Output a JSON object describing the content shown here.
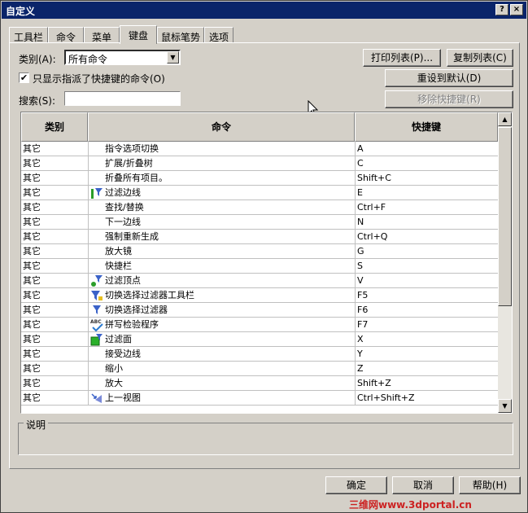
{
  "window": {
    "title": "自定义",
    "help_btn": "?",
    "close_btn": "×"
  },
  "tabs": [
    {
      "label": "工具栏"
    },
    {
      "label": "命令"
    },
    {
      "label": "菜单"
    },
    {
      "label": "键盘"
    },
    {
      "label": "鼠标笔势"
    },
    {
      "label": "选项"
    }
  ],
  "active_tab": "键盘",
  "category": {
    "label": "类别(A):",
    "value": "所有命令"
  },
  "buttons": {
    "print_list": "打印列表(P)...",
    "copy_list": "复制列表(C)",
    "reset_default": "重设到默认(D)",
    "remove_shortcut": "移除快捷键(R)"
  },
  "only_assigned": {
    "label": "只显示指派了快捷键的命令(O)",
    "checked": true,
    "mark": "✔"
  },
  "search": {
    "label": "搜索(S):",
    "value": ""
  },
  "table": {
    "headers": [
      "类别",
      "命令",
      "快捷键"
    ],
    "rows": [
      {
        "category": "其它",
        "icon": "",
        "command": "指令选项切换",
        "shortcut": "A"
      },
      {
        "category": "其它",
        "icon": "",
        "command": "扩展/折叠树",
        "shortcut": "C"
      },
      {
        "category": "其它",
        "icon": "",
        "command": "折叠所有项目。",
        "shortcut": "Shift+C"
      },
      {
        "category": "其它",
        "icon": "filter-edge-icon",
        "command": "过滤边线",
        "shortcut": "E"
      },
      {
        "category": "其它",
        "icon": "",
        "command": "查找/替换",
        "shortcut": "Ctrl+F"
      },
      {
        "category": "其它",
        "icon": "",
        "command": "下一边线",
        "shortcut": "N"
      },
      {
        "category": "其它",
        "icon": "",
        "command": "强制重新生成",
        "shortcut": "Ctrl+Q"
      },
      {
        "category": "其它",
        "icon": "",
        "command": "放大镜",
        "shortcut": "G"
      },
      {
        "category": "其它",
        "icon": "",
        "command": "快捷栏",
        "shortcut": "S"
      },
      {
        "category": "其它",
        "icon": "filter-vertex-icon",
        "command": "过滤顶点",
        "shortcut": "V"
      },
      {
        "category": "其它",
        "icon": "filter-toolbar-icon",
        "command": "切换选择过滤器工具栏",
        "shortcut": "F5"
      },
      {
        "category": "其它",
        "icon": "filter-icon",
        "command": "切换选择过滤器",
        "shortcut": "F6"
      },
      {
        "category": "其它",
        "icon": "spellcheck-icon",
        "command": "拼写检验程序",
        "shortcut": "F7"
      },
      {
        "category": "其它",
        "icon": "filter-face-icon",
        "command": "过滤面",
        "shortcut": "X"
      },
      {
        "category": "其它",
        "icon": "",
        "command": "接受边线",
        "shortcut": "Y"
      },
      {
        "category": "其它",
        "icon": "",
        "command": "缩小",
        "shortcut": "Z"
      },
      {
        "category": "其它",
        "icon": "",
        "command": "放大",
        "shortcut": "Shift+Z"
      },
      {
        "category": "其它",
        "icon": "previous-view-icon",
        "command": "上一视图",
        "shortcut": "Ctrl+Shift+Z"
      }
    ]
  },
  "description": {
    "title": "说明"
  },
  "footer": {
    "ok": "确定",
    "cancel": "取消",
    "help": "帮助(H)"
  },
  "watermark": "三维网www.3dportal.cn",
  "colors": {
    "titlebar": "#0a246a",
    "face": "#d4d0c8",
    "watermark": "#cc2222"
  }
}
